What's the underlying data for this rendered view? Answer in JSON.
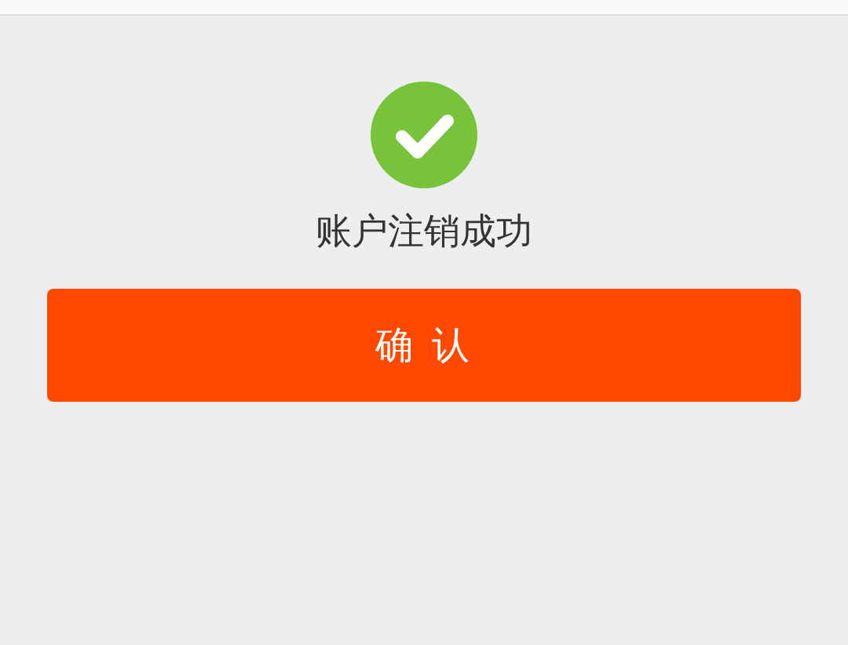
{
  "message": "账户注销成功",
  "confirm_button": {
    "label": "确 认"
  }
}
